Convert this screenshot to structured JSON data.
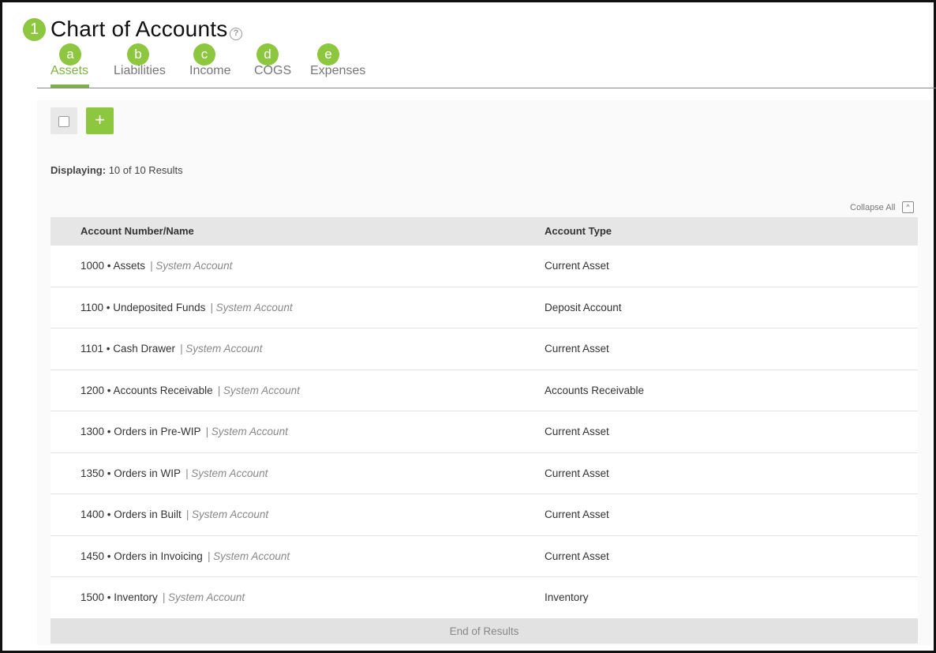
{
  "header": {
    "step_marker": "1",
    "title": "Chart of Accounts",
    "help_glyph": "?"
  },
  "tabs": [
    {
      "letter": "a",
      "label": "Assets",
      "active": true
    },
    {
      "letter": "b",
      "label": "Liabilities",
      "active": false
    },
    {
      "letter": "c",
      "label": "Income",
      "active": false
    },
    {
      "letter": "d",
      "label": "COGS",
      "active": false
    },
    {
      "letter": "e",
      "label": "Expenses",
      "active": false
    }
  ],
  "toolbar": {
    "add_glyph": "+"
  },
  "results": {
    "label": "Displaying:",
    "value": "10 of 10 Results"
  },
  "collapse": {
    "label": "Collapse All",
    "icon_glyph": "^"
  },
  "table": {
    "columns": [
      "Account Number/Name",
      "Account Type"
    ],
    "rows": [
      {
        "name": "1000 • Assets",
        "tag": "| System Account",
        "type": "Current Asset"
      },
      {
        "name": "1100 • Undeposited Funds",
        "tag": "| System Account",
        "type": "Deposit Account"
      },
      {
        "name": "1101 • Cash Drawer",
        "tag": "| System Account",
        "type": "Current Asset"
      },
      {
        "name": "1200 • Accounts Receivable",
        "tag": "| System Account",
        "type": "Accounts Receivable"
      },
      {
        "name": "1300 • Orders in Pre-WIP",
        "tag": "| System Account",
        "type": "Current Asset"
      },
      {
        "name": "1350 • Orders in WIP",
        "tag": "| System Account",
        "type": "Current Asset"
      },
      {
        "name": "1400 • Orders in Built",
        "tag": "| System Account",
        "type": "Current Asset"
      },
      {
        "name": "1450 • Orders in Invoicing",
        "tag": "| System Account",
        "type": "Current Asset"
      },
      {
        "name": "1500 • Inventory",
        "tag": "| System Account",
        "type": "Inventory"
      }
    ],
    "footer": "End of Results"
  },
  "colors": {
    "accent": "#8dc63f",
    "active_tab": "#7cb342"
  }
}
